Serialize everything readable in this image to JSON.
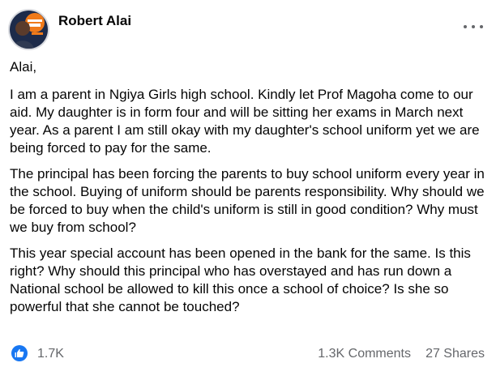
{
  "post": {
    "author": "Robert Alai",
    "more_icon": "more-horizontal-icon",
    "body": {
      "greeting": "Alai,",
      "paragraphs": [
        "I am a parent in Ngiya Girls high school. Kindly let Prof Magoha come to our aid. My daughter is in form four and will be sitting her exams in March next year. As a parent I am still okay with my daughter's school uniform yet we are being forced to pay for the same.",
        "The principal has been forcing the parents to buy school uniform every year in the school. Buying of uniform should be parents responsibility. Why should we be forced to buy when the child's uniform is still in good condition? Why must we buy from school?",
        "This year special account has been opened in the bank for the same. Is this right? Why should this principal who has overstayed and has run down a National school be allowed to kill this once a school of choice? Is she so powerful that she cannot be touched?"
      ]
    },
    "reactions": {
      "icon": "thumbs-up-icon",
      "count": "1.7K",
      "color": "#1877f2"
    },
    "comments": "1.3K Comments",
    "shares": "27 Shares"
  },
  "colors": {
    "text": "#050505",
    "secondary": "#65676b",
    "accent": "#1877f2",
    "avatar_bg": "#e8771f"
  }
}
